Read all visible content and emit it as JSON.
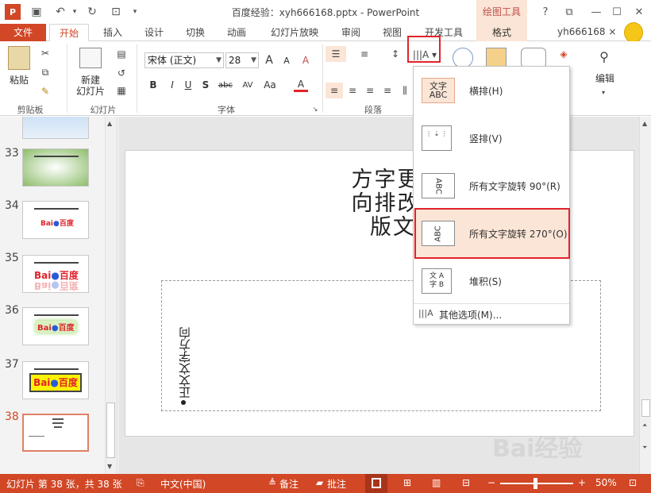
{
  "title_bar": {
    "title": "百度经验：xyh666168.pptx - PowerPoint",
    "contextual_tool": "绘图工具",
    "help": "?",
    "restore": "⧉",
    "minimize": "—",
    "maximize": "☐",
    "close": "✕"
  },
  "tabs": {
    "file": "文件",
    "home": "开始",
    "insert": "插入",
    "design": "设计",
    "transitions": "切换",
    "animations": "动画",
    "slideshow": "幻灯片放映",
    "review": "审阅",
    "view": "视图",
    "developer": "开发工具",
    "format": "格式",
    "user": "yh666168 ×"
  },
  "ribbon": {
    "clipboard": {
      "paste": "粘贴",
      "label": "剪贴板"
    },
    "slides": {
      "new_slide_line1": "新建",
      "new_slide_line2": "幻灯片",
      "label": "幻灯片"
    },
    "font": {
      "name": "宋体 (正文)",
      "size": "28",
      "grow": "A",
      "shrink": "A",
      "clear": "A",
      "bold": "B",
      "italic": "I",
      "underline": "U",
      "shadow": "S",
      "strike": "abc",
      "spacing": "AV",
      "case": "Aa",
      "color": "A",
      "label": "字体"
    },
    "paragraph": {
      "label": "段落"
    },
    "editing": {
      "label": "编辑"
    }
  },
  "slide_panel": {
    "slides": [
      {
        "num": "33"
      },
      {
        "num": "34"
      },
      {
        "num": "35"
      },
      {
        "num": "36"
      },
      {
        "num": "37"
      },
      {
        "num": "38"
      }
    ],
    "logo_text": "Bai",
    "logo_text_cn": "百度"
  },
  "slide": {
    "title_line1": "方字更",
    "title_line2": "向排改",
    "title_line3": "版文",
    "vertical_text": "正文文字方向"
  },
  "text_direction_menu": {
    "horizontal": "横排(H)",
    "vertical": "竖排(V)",
    "rotate90": "所有文字旋转 90°(R)",
    "rotate270": "所有文字旋转 270°(O)",
    "stacked": "堆积(S)",
    "more": "其他选项(M)...",
    "icon_text_cn": "文字",
    "icon_text_en": "ABC"
  },
  "status_bar": {
    "slide_info": "幻灯片 第 38 张，共 38 张",
    "language": "中文(中国)",
    "notes": "备注",
    "comments": "批注",
    "zoom": "50%",
    "zoom_out": "−",
    "zoom_in": "+"
  },
  "watermark": "Bai经验",
  "colors": {
    "accent": "#d24726",
    "highlight": "#e1232b",
    "selected_bg": "#fbe5d6"
  }
}
